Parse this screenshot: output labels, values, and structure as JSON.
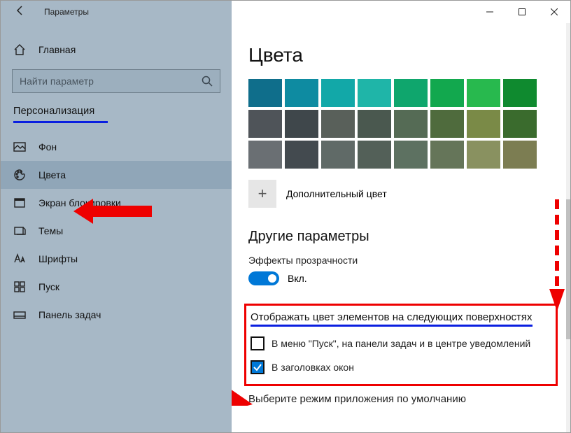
{
  "titlebar": {
    "title": "Параметры"
  },
  "sidebar": {
    "home": "Главная",
    "search_placeholder": "Найти параметр",
    "section": "Персонализация",
    "items": [
      {
        "label": "Фон"
      },
      {
        "label": "Цвета"
      },
      {
        "label": "Экран блокировки"
      },
      {
        "label": "Темы"
      },
      {
        "label": "Шрифты"
      },
      {
        "label": "Пуск"
      },
      {
        "label": "Панель задач"
      }
    ]
  },
  "content": {
    "heading": "Цвета",
    "palette": [
      [
        "#0f6e8b",
        "#0e8ba1",
        "#12a8a8",
        "#1fb5a8",
        "#0fa66d",
        "#12a84e",
        "#28b94e",
        "#0f8a2f"
      ],
      [
        "#4f5459",
        "#3f474b",
        "#59605a",
        "#4a584f",
        "#556b55",
        "#4f6b3d",
        "#7a8a47",
        "#3a6b2d"
      ],
      [
        "#6a6f73",
        "#434a4f",
        "#606a67",
        "#536058",
        "#5d7161",
        "#657559",
        "#899160",
        "#7c7d52"
      ]
    ],
    "custom_color": "Дополнительный цвет",
    "more_heading": "Другие параметры",
    "transparency_label": "Эффекты прозрачности",
    "toggle_on": "Вкл.",
    "show_accent_title": "Отображать цвет элементов на следующих поверхностях",
    "chk_start": "В меню \"Пуск\", на панели задач и в центре уведомлений",
    "chk_titlebars": "В заголовках окон",
    "app_mode": "Выберите режим приложения по умолчанию"
  }
}
